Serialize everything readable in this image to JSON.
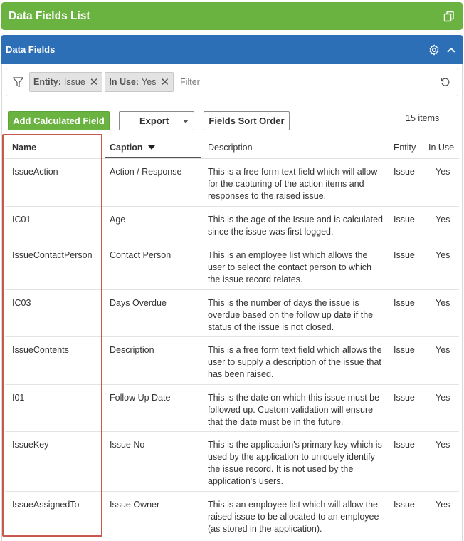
{
  "topbar": {
    "title": "Data Fields List",
    "icon": "copy-icon",
    "color": "#6bb341"
  },
  "panel": {
    "title": "Data Fields",
    "settings_icon": "gear-icon",
    "collapse_icon": "chevron-up-icon",
    "color": "#2c6fb6"
  },
  "filter": {
    "chips": [
      {
        "key": "Entity:",
        "value": "Issue"
      },
      {
        "key": "In Use:",
        "value": "Yes"
      }
    ],
    "placeholder": "Filter"
  },
  "toolbar": {
    "add_label": "Add Calculated Field",
    "export_label": "Export",
    "sort_label": "Fields Sort Order",
    "items_count": "15 items"
  },
  "table": {
    "headers": {
      "name": "Name",
      "caption": "Caption",
      "description": "Description",
      "entity": "Entity",
      "in_use": "In Use"
    },
    "rows": [
      {
        "name": "IssueAction",
        "caption": "Action / Response",
        "description": "This is a free form text field which will allow for the capturing of the action items and responses to the raised issue.",
        "entity": "Issue",
        "in_use": "Yes"
      },
      {
        "name": "IC01",
        "caption": "Age",
        "description": "This is the age of the Issue and is calculated since the issue was first logged.",
        "entity": "Issue",
        "in_use": "Yes"
      },
      {
        "name": "IssueContactPerson",
        "caption": "Contact Person",
        "description": "This is an employee list which allows the user to select the contact person to which the issue record relates.",
        "entity": "Issue",
        "in_use": "Yes"
      },
      {
        "name": "IC03",
        "caption": "Days Overdue",
        "description": "This is the number of days the issue is overdue based on the follow up date if the status of the issue is not closed.",
        "entity": "Issue",
        "in_use": "Yes"
      },
      {
        "name": "IssueContents",
        "caption": "Description",
        "description": "This is a free form text field which allows the user to supply a description of the issue that has been raised.",
        "entity": "Issue",
        "in_use": "Yes"
      },
      {
        "name": "I01",
        "caption": "Follow Up Date",
        "description": "This is the date on which this issue must be followed up. Custom validation will ensure that the date must be in the future.",
        "entity": "Issue",
        "in_use": "Yes"
      },
      {
        "name": "IssueKey",
        "caption": "Issue No",
        "description": "This is the application's primary key which is used by the application to uniquely identify the issue record. It is not used by the application's users.",
        "entity": "Issue",
        "in_use": "Yes"
      },
      {
        "name": "IssueAssignedTo",
        "caption": "Issue Owner",
        "description": "This is an employee list which will allow the raised issue to be allocated to an employee (as stored in the application).",
        "entity": "Issue",
        "in_use": "Yes"
      }
    ]
  }
}
